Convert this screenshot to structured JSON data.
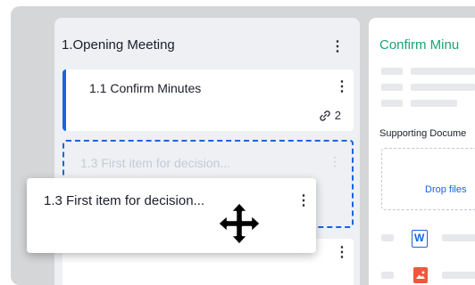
{
  "column": {
    "title": "1.Opening Meeting",
    "kebab": "⋮"
  },
  "cards": [
    {
      "title": "1.1  Confirm Minutes",
      "link_count": "2",
      "kebab": "⋮"
    }
  ],
  "placeholder": {
    "title": "1.3  First item for decision...",
    "kebab": "⋮"
  },
  "dragging_card": {
    "title": "1.3  First item for decision...",
    "kebab": "⋮"
  },
  "lower_card": {
    "kebab": "⋮"
  },
  "panel": {
    "title": "Confirm Minu",
    "supporting_label": "Supporting Docume",
    "drop_text": "Drop files",
    "word_letter": "W"
  },
  "colors": {
    "accent": "#1566e0",
    "panel_title": "#17a673",
    "image_file": "#f2573d"
  },
  "icons": [
    "kebab-menu-icon",
    "link-icon",
    "move-cursor-icon",
    "word-file-icon",
    "image-file-icon"
  ]
}
